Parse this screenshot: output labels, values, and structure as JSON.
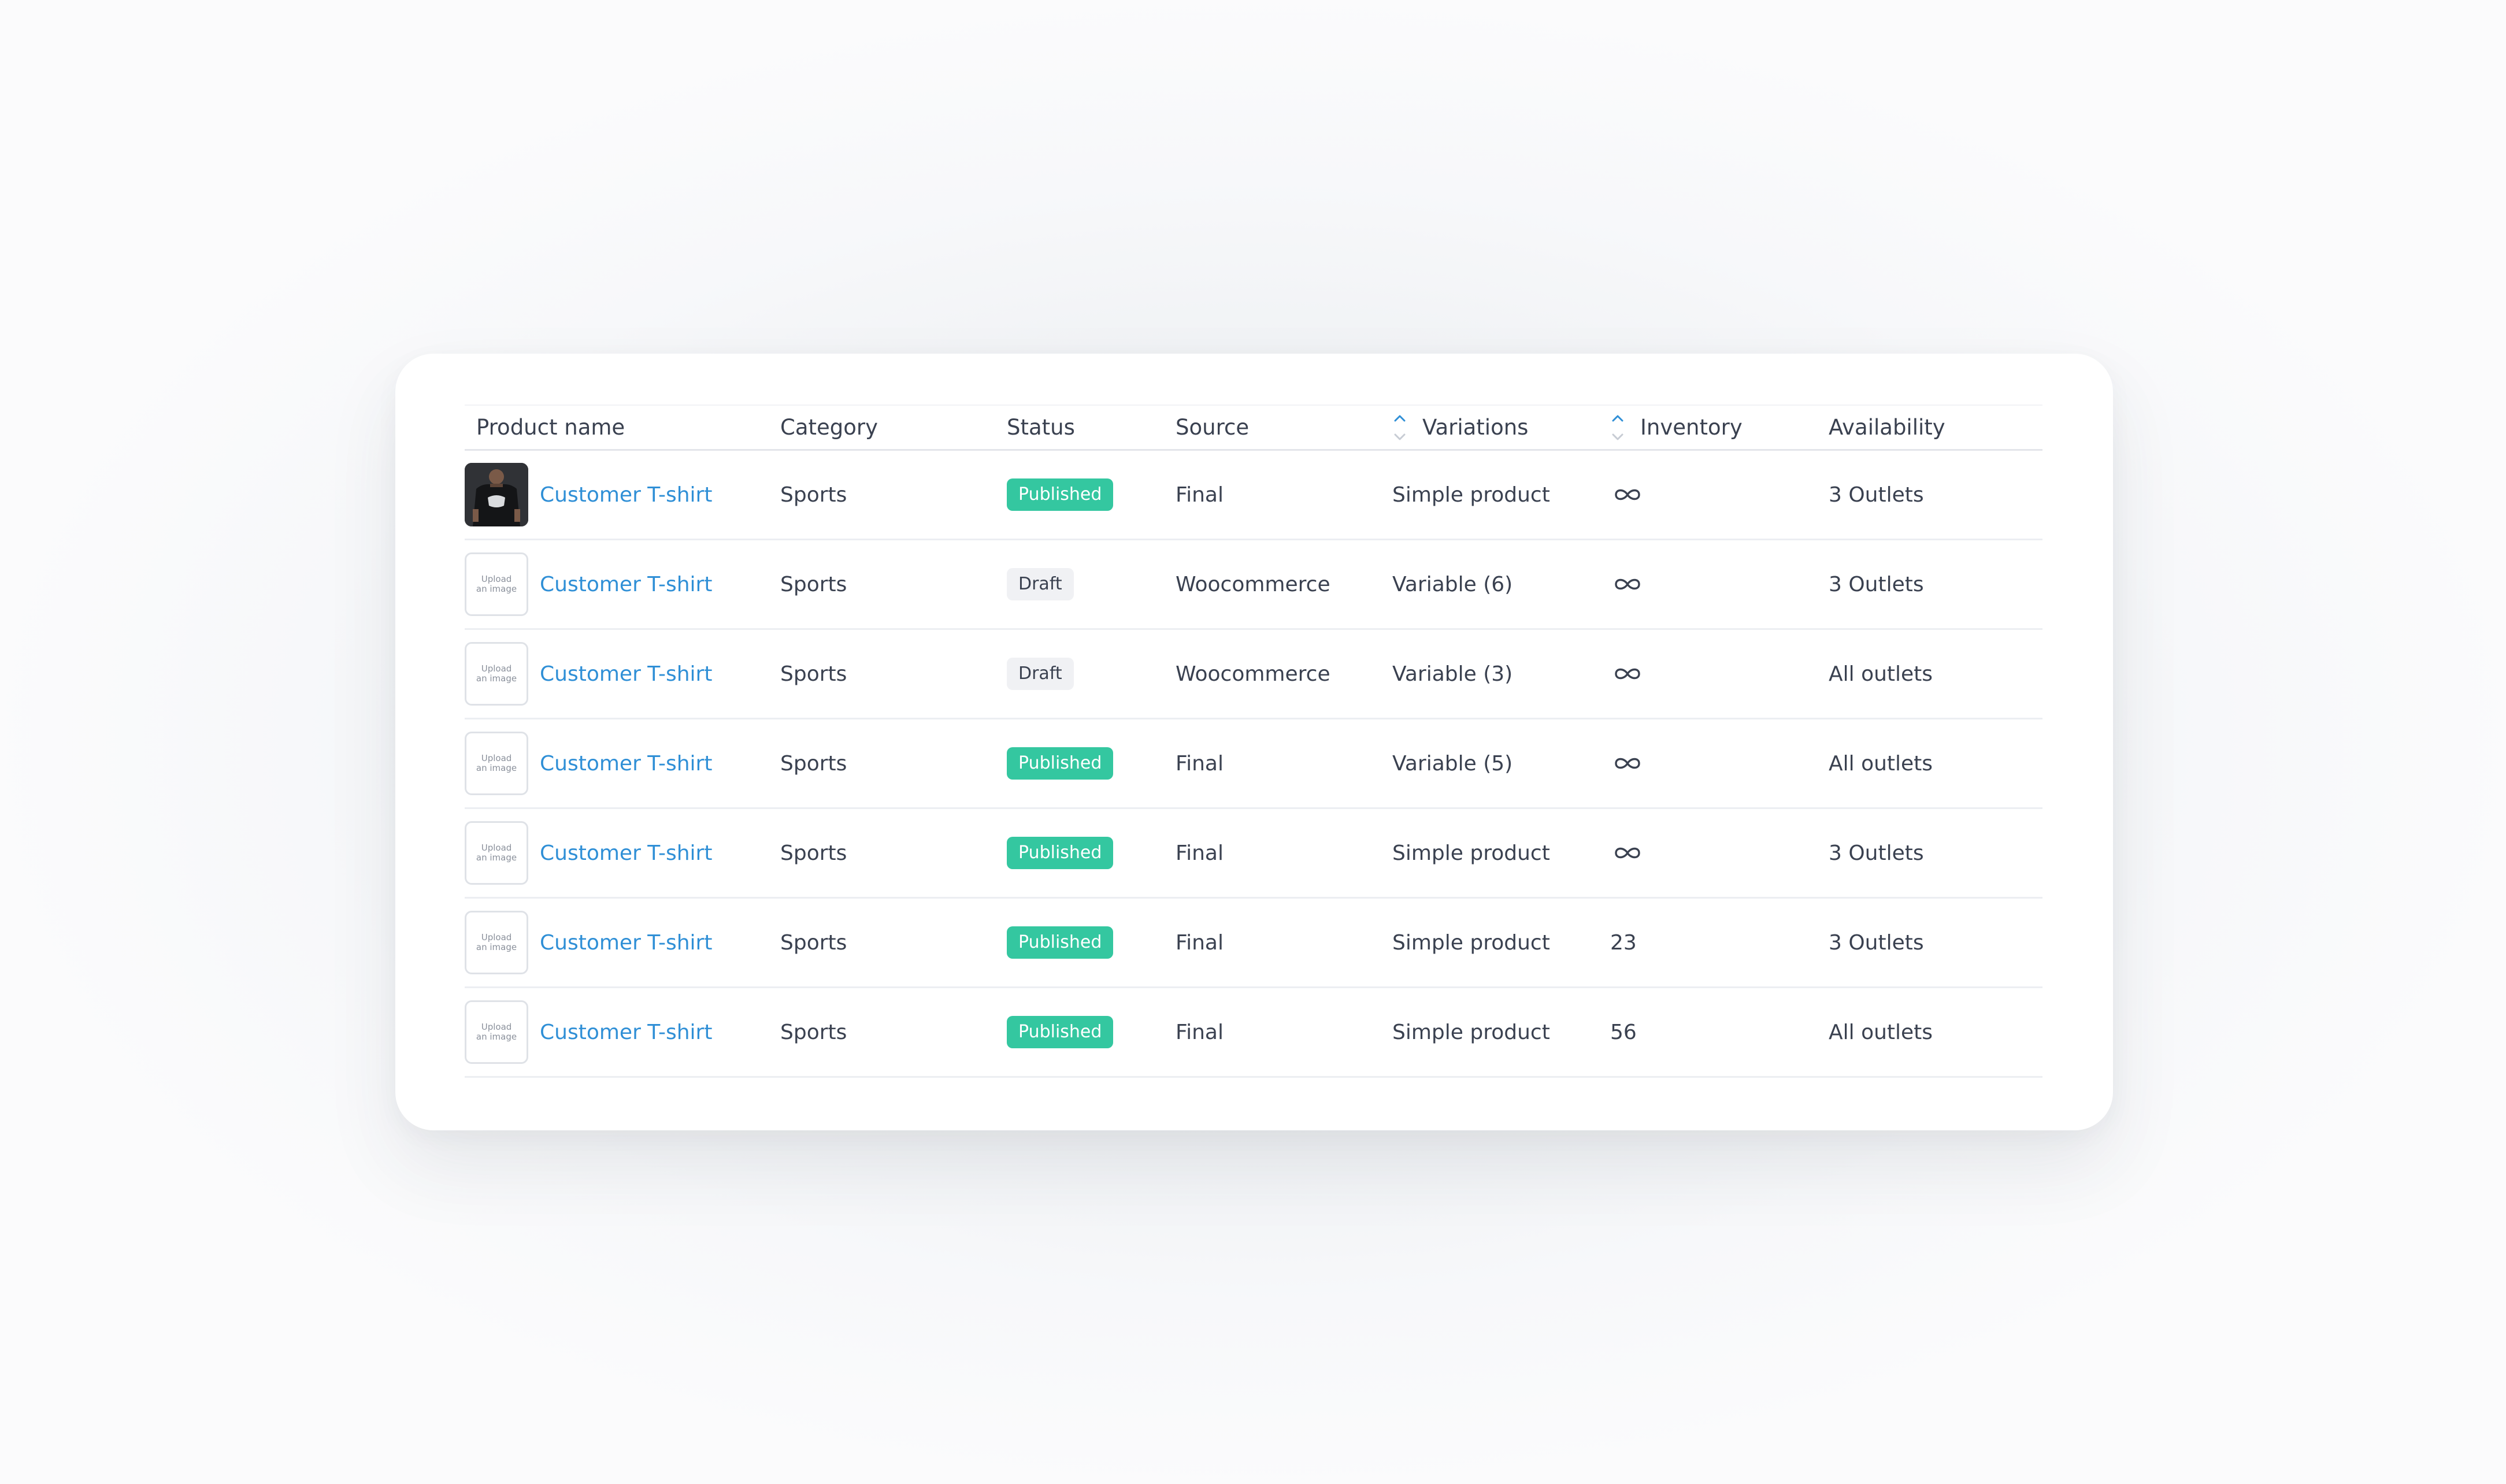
{
  "colors": {
    "link": "#2f8fd6",
    "published": "#34c7a0",
    "draft_bg": "#f0f1f4",
    "text": "#3a4150",
    "sort_up_active": "#2f8fd6"
  },
  "table": {
    "headers": {
      "product_name": "Product name",
      "category": "Category",
      "status": "Status",
      "source": "Source",
      "variations": "Variations",
      "inventory": "Inventory",
      "availability": "Availability"
    },
    "upload_placeholder": {
      "line1": "Upload",
      "line2": "an image"
    },
    "rows": [
      {
        "name": "Customer T-shirt",
        "thumb": "photo",
        "category": "Sports",
        "status": "Published",
        "status_kind": "published",
        "source": "Final",
        "variations": "Simple product",
        "inventory": "∞",
        "inventory_icon": "infinity-icon",
        "availability": "3 Outlets"
      },
      {
        "name": "Customer T-shirt",
        "thumb": "upload",
        "category": "Sports",
        "status": "Draft",
        "status_kind": "draft",
        "source": "Woocommerce",
        "variations": "Variable (6)",
        "inventory": "∞",
        "inventory_icon": "infinity-icon",
        "availability": "3 Outlets"
      },
      {
        "name": "Customer T-shirt",
        "thumb": "upload",
        "category": "Sports",
        "status": "Draft",
        "status_kind": "draft",
        "source": "Woocommerce",
        "variations": "Variable (3)",
        "inventory": "∞",
        "inventory_icon": "infinity-icon",
        "availability": "All outlets"
      },
      {
        "name": "Customer T-shirt",
        "thumb": "upload",
        "category": "Sports",
        "status": "Published",
        "status_kind": "published",
        "source": "Final",
        "variations": "Variable (5)",
        "inventory": "∞",
        "inventory_icon": "infinity-icon",
        "availability": "All outlets"
      },
      {
        "name": "Customer T-shirt",
        "thumb": "upload",
        "category": "Sports",
        "status": "Published",
        "status_kind": "published",
        "source": "Final",
        "variations": "Simple product",
        "inventory": "∞",
        "inventory_icon": "infinity-icon",
        "availability": "3 Outlets"
      },
      {
        "name": "Customer T-shirt",
        "thumb": "upload",
        "category": "Sports",
        "status": "Published",
        "status_kind": "published",
        "source": "Final",
        "variations": "Simple product",
        "inventory": "23",
        "inventory_icon": "",
        "availability": "3 Outlets"
      },
      {
        "name": "Customer T-shirt",
        "thumb": "upload",
        "category": "Sports",
        "status": "Published",
        "status_kind": "published",
        "source": "Final",
        "variations": "Simple product",
        "inventory": "56",
        "inventory_icon": "",
        "availability": "All outlets"
      }
    ]
  }
}
